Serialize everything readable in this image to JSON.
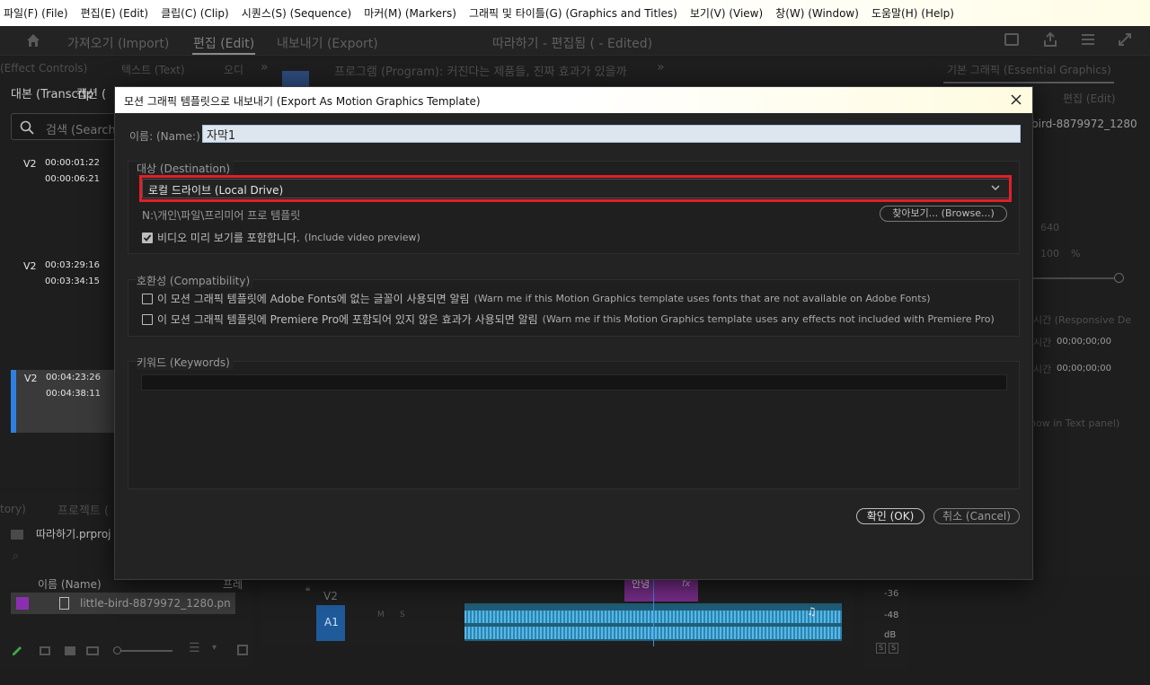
{
  "menubar": {
    "items": [
      "파일(F) (File)",
      "편집(E) (Edit)",
      "클립(C) (Clip)",
      "시퀀스(S) (Sequence)",
      "마커(M) (Markers)",
      "그래픽 및 타이틀(G) (Graphics and Titles)",
      "보기(V) (View)",
      "창(W) (Window)",
      "도움말(H) (Help)"
    ]
  },
  "workspace": {
    "import": "가져오기 (Import)",
    "edit": "편집 (Edit)",
    "export": "내보내기 (Export)",
    "doc_title": "따라하기 - 편집됨 ( - Edited)"
  },
  "panels": {
    "effect_controls": "(Effect Controls)",
    "text": "텍스트 (Text)",
    "o": "오디",
    "program": "프로그램 (Program): 커진다는 제품들, 진짜 효과가 있을까",
    "essential_graphics": "기본 그래픽 (Essential Graphics)",
    "transcript": "대본 (Transcrip",
    "caption": "캡션 (",
    "search_placeholder": "검색 (Search",
    "history": "tory)",
    "project": "프로젝트 (",
    "project_file": "따라하기.prproj",
    "col_name": "이름 (Name)",
    "col_frame": "프레",
    "asset_file": "little-bird-8879972_1280.pn",
    "right_file": "bird-8879972_1280",
    "right_edit": "편집 (Edit)",
    "right_v1": "640",
    "right_v2": "100",
    "right_pct": "%",
    "right_resp1": "시간 (Responsive De",
    "right_resp2": "시간",
    "right_resp3": "시간",
    "right_tc1": "00;00;00;00",
    "right_tc2": "00;00;00;00",
    "right_show": "how in Text panel)"
  },
  "transcript_clips": [
    {
      "track": "V2",
      "start": "00:00:01:22",
      "end": "00:00:06:21"
    },
    {
      "track": "V2",
      "start": "00:03:29:16",
      "end": "00:03:34:15"
    },
    {
      "track": "V2",
      "start": "00:04:23:26",
      "end": "00:04:38:11"
    }
  ],
  "timeline": {
    "track_v2": "V2",
    "track_a1": "A1",
    "m": "M",
    "s": "S",
    "clip_label": "안녕",
    "fx": "fx",
    "db_36": "-36",
    "db_48": "-48",
    "db": "dB",
    "meter_s1": "S",
    "meter_s2": "S"
  },
  "dialog": {
    "title": "모션 그래픽 템플릿으로 내보내기 (Export As Motion Graphics Template)",
    "name_label": "이름: (Name:)",
    "name_value": "자막1",
    "destination_title": "대상 (Destination)",
    "destination_value": "로컬 드라이브 (Local Drive)",
    "path": "N:\\개인\\파일\\프리미어 프로 템플릿",
    "browse": "찾아보기... (Browse...)",
    "include_preview_ko": "비디오 미리 보기를 포함합니다.",
    "include_preview_en": "(Include video preview)",
    "compat_title": "호환성 (Compatibility)",
    "warn_fonts_ko": "이 모션 그래픽 템플릿에 Adobe Fonts에 없는 글꼴이 사용되면 알림",
    "warn_fonts_en": "(Warn me if this Motion Graphics template uses fonts that are not available on Adobe Fonts)",
    "warn_effects_ko": "이 모션 그래픽 템플릿에 Premiere Pro에 포함되어 있지 않은 효과가 사용되면 알림",
    "warn_effects_en": "(Warn me if this Motion Graphics template uses any effects not included with Premiere Pro)",
    "keywords_title": "키워드 (Keywords)",
    "ok": "확인 (OK)",
    "cancel": "취소 (Cancel)"
  },
  "colors": {
    "highlight": "#e0202a",
    "selection_accent": "#2f7fe0",
    "audio_wave": "#58b8e8"
  }
}
